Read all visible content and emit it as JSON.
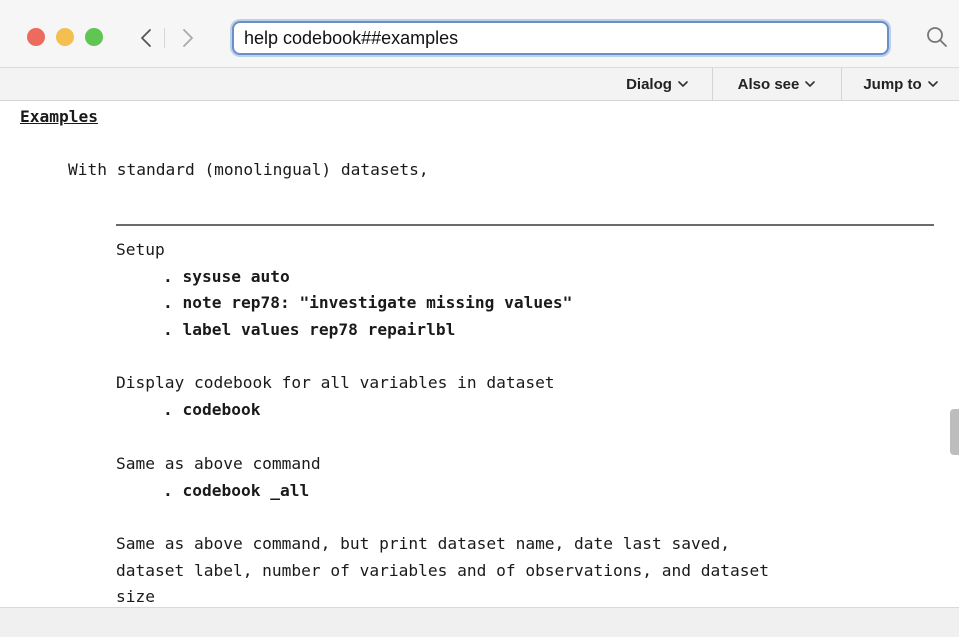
{
  "toolbar": {
    "address_value": "help codebook##examples"
  },
  "menus": {
    "dialog": "Dialog",
    "also_see": "Also see",
    "jump_to": "Jump to"
  },
  "content": {
    "heading": "Examples",
    "intro": "With standard (monolingual) datasets,",
    "blocks": [
      {
        "description": [
          "Setup"
        ],
        "commands": [
          ". sysuse auto",
          ". note rep78: \"investigate missing values\"",
          ". label values rep78 repairlbl"
        ]
      },
      {
        "description": [
          "Display codebook for all variables in dataset"
        ],
        "commands": [
          ". codebook"
        ]
      },
      {
        "description": [
          "Same as above command"
        ],
        "commands": [
          ". codebook _all"
        ]
      },
      {
        "description": [
          "Same as above command, but print dataset name, date last saved,",
          "dataset label, number of variables and of observations, and dataset",
          "size"
        ],
        "commands": []
      }
    ]
  },
  "icons": {
    "back": "chevron-left-icon",
    "forward": "chevron-right-icon",
    "search": "magnifier-icon",
    "menu_arrow": "chevron-down-icon"
  },
  "colors": {
    "close": "#ed6a5e",
    "minimize": "#f4bf4f",
    "zoom": "#61c554",
    "address_focus": "#6a8fc4"
  }
}
